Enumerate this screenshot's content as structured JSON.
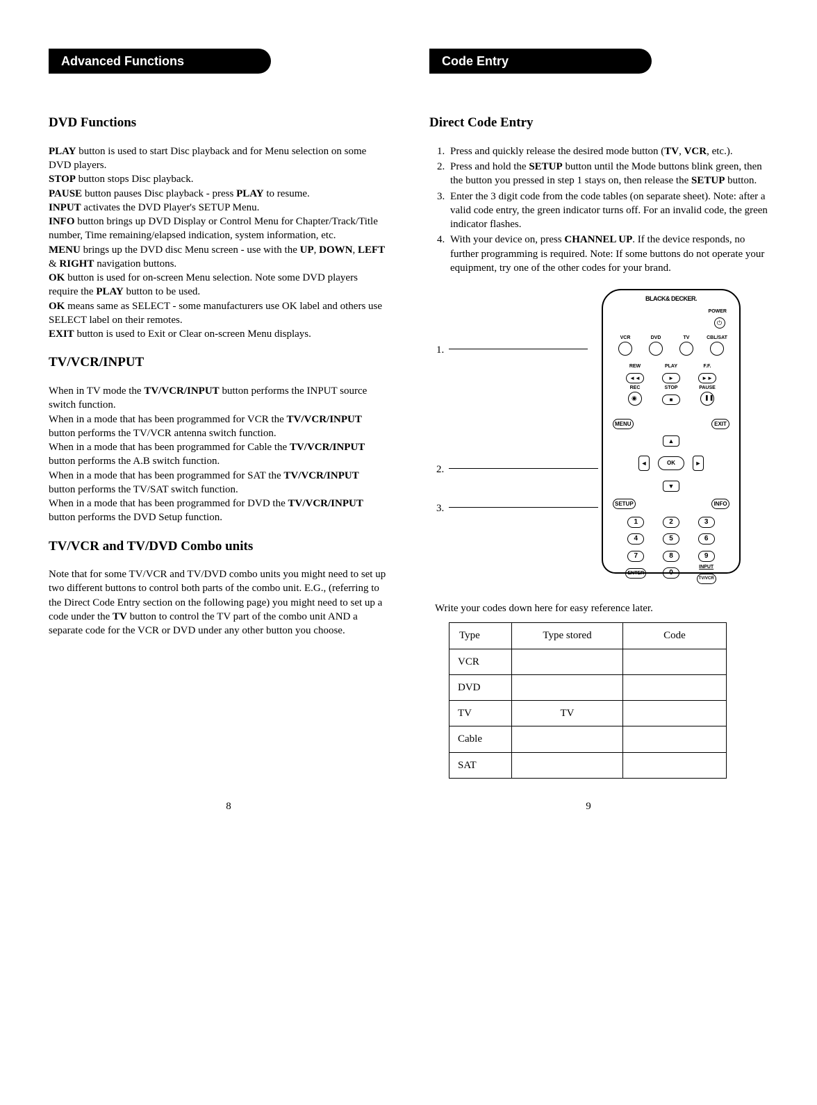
{
  "left": {
    "tab": "Advanced Functions",
    "h_dvd": "DVD Functions",
    "dvd_lines": [
      {
        "b": "PLAY",
        "t": " button is used to start Disc playback and for Menu selection on some DVD players."
      },
      {
        "b": "STOP",
        "t": " button stops Disc playback."
      },
      {
        "b": "PAUSE",
        "t": " button pauses Disc playback - press ",
        "b2": "PLAY",
        "t2": " to resume."
      },
      {
        "b": "INPUT",
        "t": " activates the DVD Player's SETUP Menu."
      },
      {
        "b": "INFO",
        "t": " button brings up DVD Display or Control Menu for Chapter/Track/Title number, Time remaining/elapsed indication, system information, etc."
      },
      {
        "b": "MENU",
        "t": " brings up the DVD disc Menu screen - use with the ",
        "b2": "UP",
        "t2": ", ",
        "b3": "DOWN",
        "t3": ", ",
        "b4": "LEFT",
        "t4": " & ",
        "b5": "RIGHT",
        "t5": " navigation buttons."
      },
      {
        "b": "OK",
        "t": " button is used for on-screen Menu selection. Note some DVD players require the ",
        "b2": "PLAY",
        "t2": " button to be used."
      },
      {
        "b": "OK",
        "t": " means same as SELECT - some manufacturers use OK label and others use SELECT label on their remotes."
      },
      {
        "b": "EXIT",
        "t": " button is used to Exit or Clear on-screen Menu displays."
      }
    ],
    "h_tvvcr": "TV/VCR/INPUT",
    "tvvcr_paras": [
      {
        "pre": "When in TV mode the ",
        "b": "TV/VCR/INPUT",
        "post": " button performs the  INPUT source switch function."
      },
      {
        "pre": "When in a mode that has been programmed for VCR the ",
        "b": "TV/VCR/INPUT",
        "post": " button performs the TV/VCR antenna switch function."
      },
      {
        "pre": "When in a mode that has been programmed for Cable the ",
        "b": "TV/VCR/INPUT",
        "post": " button performs the A.B switch function."
      },
      {
        "pre": "When in a mode that has been programmed for SAT the ",
        "b": "TV/VCR/INPUT",
        "post": " button performs the TV/SAT switch function."
      },
      {
        "pre": "When in a mode that has been programmed for DVD the ",
        "b": "TV/VCR/INPUT",
        "post": " button performs the DVD Setup function."
      }
    ],
    "h_combo": "TV/VCR and TV/DVD Combo units",
    "combo_p1": "Note that for some TV/VCR and TV/DVD combo units you might need to set up two different buttons to control both parts of the combo unit. E.G., (referring to the  Direct Code Entry section on the following page) you might need to set up a code under the ",
    "combo_b": "TV",
    "combo_p2": " button to control the TV part of the combo unit AND a separate code for the VCR or DVD under any other button you choose.",
    "page_num": "8"
  },
  "right": {
    "tab": "Code Entry",
    "h_direct": "Direct Code Entry",
    "steps": [
      {
        "s": "Press and quickly release the desired mode button (",
        "sc1": "TV",
        "m1": ", ",
        "sc2": "VCR",
        "m2": ", etc.)."
      },
      {
        "s": "Press and hold the ",
        "sc1": "SETUP",
        "m1": " button until the Mode buttons blink green, then the button you pressed in step 1 stays on, then release the ",
        "sc2": "SETUP",
        "m2": " button."
      },
      {
        "s": "Enter the 3 digit code from the code tables (on separate sheet). Note: after a valid code entry, the green indicator turns off.  For an invalid code, the green indicator flashes."
      },
      {
        "s": "With your device on, press ",
        "sc1": "CHANNEL UP",
        "m1": ". If the device responds, no further programming is required. Note: If some buttons do not operate your equipment, try one of the other codes for your brand."
      }
    ],
    "callouts": {
      "c1": "1.",
      "c2": "2.",
      "c3": "3."
    },
    "remote": {
      "brand": "BLACK& DECKER.",
      "power": "POWER",
      "modes": [
        "VCR",
        "DVD",
        "TV",
        "CBL/SAT"
      ],
      "row_transport_labels": [
        "REW",
        "PLAY",
        "F.F."
      ],
      "row_transport2_labels": [
        "REC",
        "STOP",
        "PAUSE"
      ],
      "menu": "MENU",
      "exit": "EXIT",
      "ok": "OK",
      "setup": "SETUP",
      "info": "INFO",
      "nums": [
        "1",
        "2",
        "3",
        "4",
        "5",
        "6",
        "7",
        "8",
        "9",
        "0"
      ],
      "enter": "ENTER",
      "input": "INPUT",
      "tvvcr": "TV/VCR"
    },
    "table_caption": "Write your codes down here for easy reference later.",
    "table": {
      "headers": [
        "Type",
        "Type stored",
        "Code"
      ],
      "rows": [
        {
          "type": "VCR",
          "stored": "",
          "code": ""
        },
        {
          "type": "DVD",
          "stored": "",
          "code": ""
        },
        {
          "type": "TV",
          "stored": "TV",
          "code": ""
        },
        {
          "type": "Cable",
          "stored": "",
          "code": ""
        },
        {
          "type": "SAT",
          "stored": "",
          "code": ""
        }
      ]
    },
    "page_num": "9"
  }
}
